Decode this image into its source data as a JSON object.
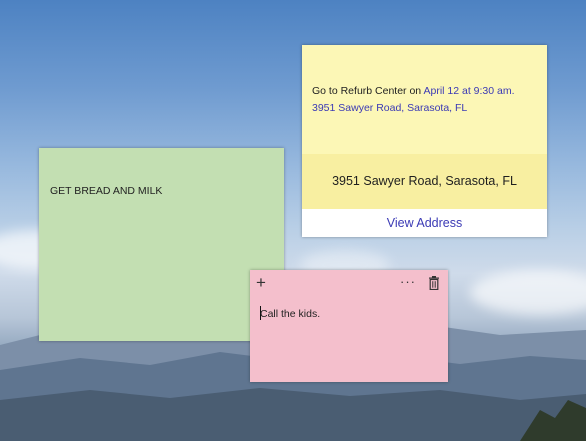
{
  "notes": {
    "yellow": {
      "text_prefix": "Go to Refurb Center on ",
      "date_link": "April 12 at 9:30 am.",
      "address_link": "3951 Sawyer Road, Sarasota, FL",
      "card_title": "3951 Sawyer Road, Sarasota, FL",
      "card_button": "View Address",
      "color": "#fcf7b6"
    },
    "green": {
      "text": "GET BREAD AND MILK",
      "color": "#c3dfb2"
    },
    "pink": {
      "add_glyph": "+",
      "more_glyph": "···",
      "text": "Call the kids.",
      "color": "#f4bfcc"
    }
  },
  "colors": {
    "link": "#3b3ab5"
  }
}
